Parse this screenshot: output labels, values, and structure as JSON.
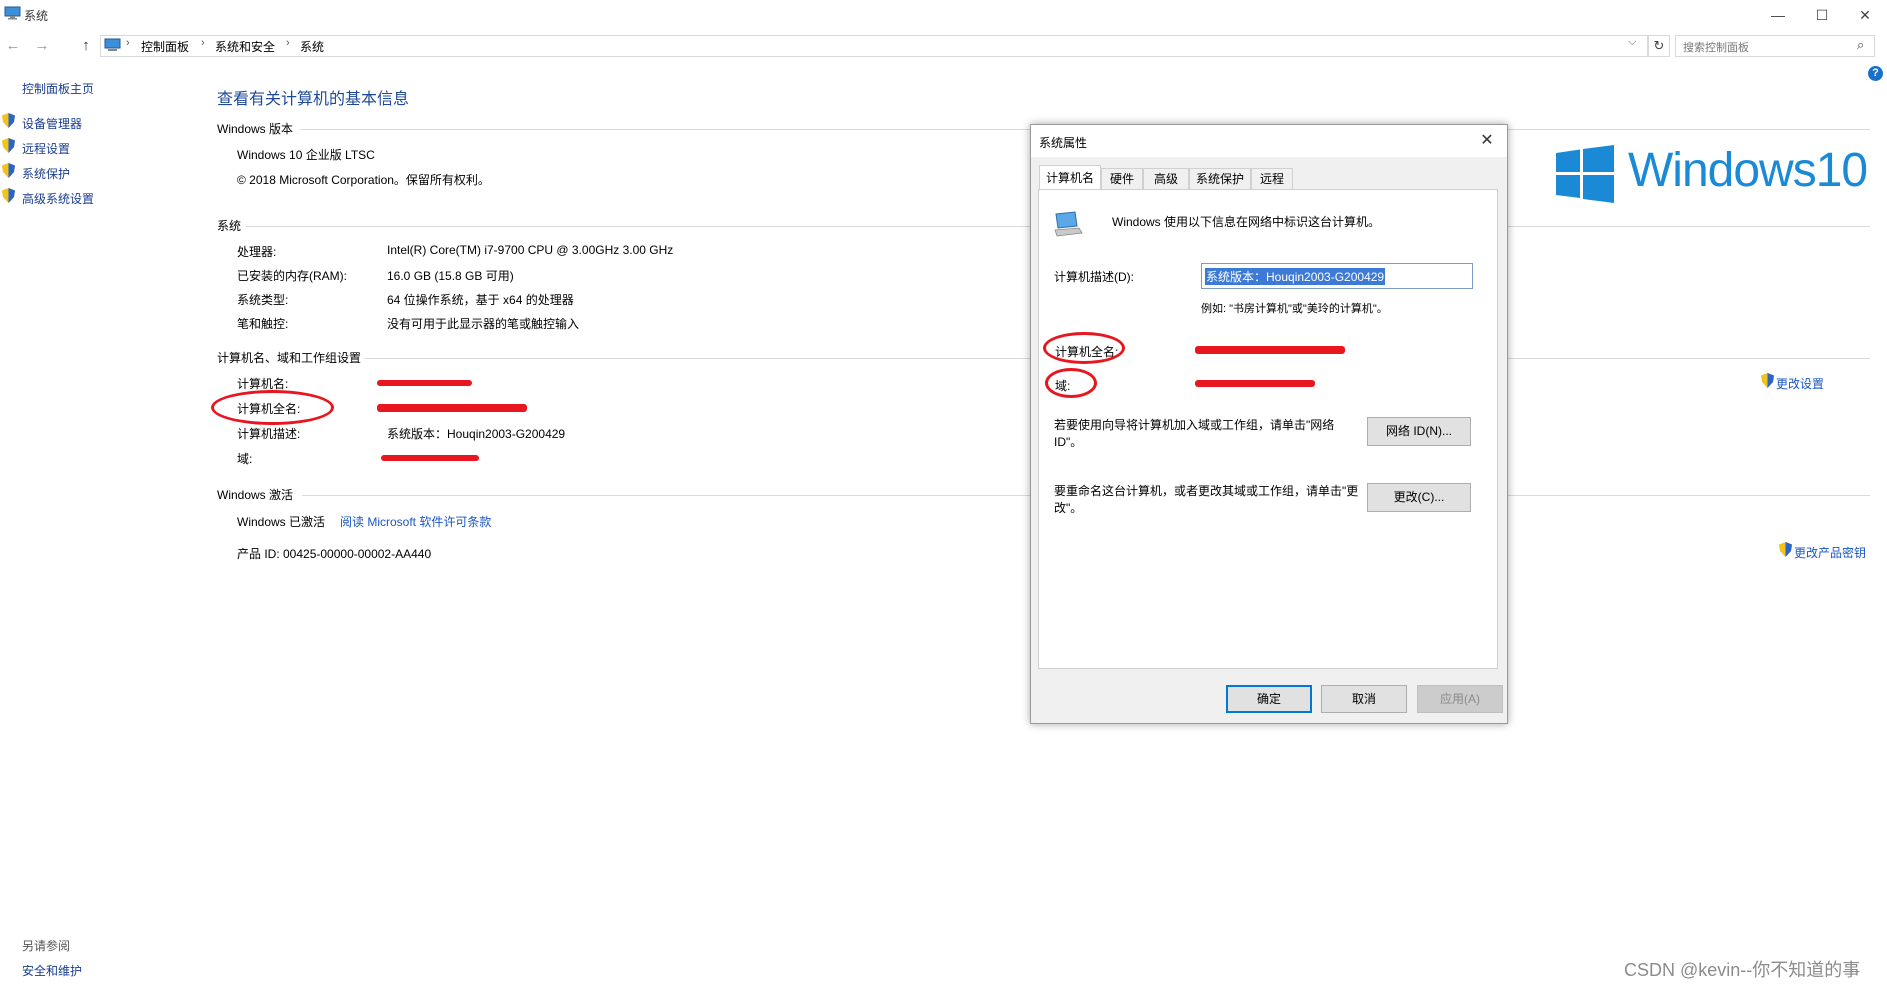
{
  "window": {
    "title": "系统",
    "controls": {
      "minimize": "—",
      "maximize": "☐",
      "close": "✕"
    }
  },
  "address": {
    "crumbs": [
      "控制面板",
      "系统和安全",
      "系统"
    ],
    "separator": "›",
    "dropdown": "⌵",
    "refresh": "↻",
    "search_placeholder": "搜索控制面板",
    "search_icon": "⌕"
  },
  "nav": {
    "back": "←",
    "forward": "→",
    "up": "↑"
  },
  "sidebar": {
    "home": "控制面板主页",
    "items": [
      {
        "label": "设备管理器",
        "icon": "shield-icon"
      },
      {
        "label": "远程设置",
        "icon": "shield-icon"
      },
      {
        "label": "系统保护",
        "icon": "shield-icon"
      },
      {
        "label": "高级系统设置",
        "icon": "shield-icon"
      }
    ],
    "see_also_title": "另请参阅",
    "see_also_link": "安全和维护"
  },
  "main": {
    "title": "查看有关计算机的基本信息",
    "edition_section": "Windows 版本",
    "edition": "Windows 10 企业版 LTSC",
    "copyright": "© 2018 Microsoft Corporation。保留所有权利。",
    "system_section": "系统",
    "system_rows": [
      {
        "label": "处理器:",
        "value": "Intel(R) Core(TM) i7-9700 CPU @ 3.00GHz   3.00 GHz"
      },
      {
        "label": "已安装的内存(RAM):",
        "value": "16.0 GB (15.8 GB 可用)"
      },
      {
        "label": "系统类型:",
        "value": "64 位操作系统，基于 x64 的处理器"
      },
      {
        "label": "笔和触控:",
        "value": "没有可用于此显示器的笔或触控输入"
      }
    ],
    "name_section": "计算机名、域和工作组设置",
    "name_rows": [
      {
        "label": "计算机名:",
        "value": ""
      },
      {
        "label": "计算机全名:",
        "value": ""
      },
      {
        "label": "计算机描述:",
        "value": "系统版本：Houqin2003-G200429"
      },
      {
        "label": "域:",
        "value": ""
      }
    ],
    "change_settings": "更改设置",
    "activation_section": "Windows 激活",
    "activated": "Windows 已激活",
    "license_link": "阅读 Microsoft 软件许可条款",
    "product_id": "产品 ID: 00425-00000-00002-AA440",
    "change_key": "更改产品密钥",
    "win_logo_text": "Windows10"
  },
  "dialog": {
    "title": "系统属性",
    "close": "✕",
    "tabs": [
      "计算机名",
      "硬件",
      "高级",
      "系统保护",
      "远程"
    ],
    "active_tab": "计算机名",
    "intro": "Windows 使用以下信息在网络中标识这台计算机。",
    "desc_label": "计算机描述(D):",
    "desc_value": "系统版本：Houqin2003-G200429",
    "desc_hint": "例如: \"书房计算机\"或\"美玲的计算机\"。",
    "full_name_label": "计算机全名:",
    "domain_label": "域:",
    "netid_text": "若要使用向导将计算机加入域或工作组，请单击\"网络 ID\"。",
    "netid_button": "网络 ID(N)...",
    "rename_text": "要重命名这台计算机，或者更改其域或工作组，请单击\"更改\"。",
    "change_button": "更改(C)...",
    "ok": "确定",
    "cancel": "取消",
    "apply": "应用(A)"
  },
  "help": "?",
  "watermark": "CSDN @kevin--你不知道的事",
  "colors": {
    "link": "#1a56c4",
    "title_blue": "#1e4a9a",
    "annotation_red": "#e8161e",
    "win_blue": "#1a8ad6"
  }
}
